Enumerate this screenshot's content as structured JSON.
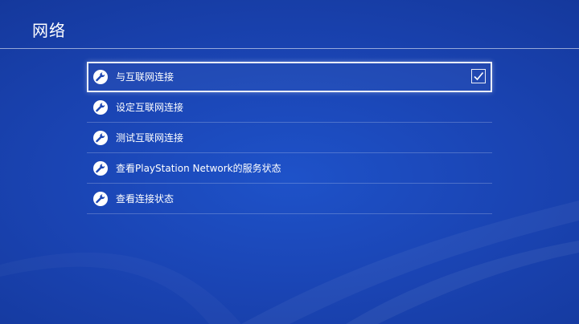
{
  "header": {
    "title": "网络"
  },
  "menu": {
    "items": [
      {
        "label": "与互联网连接",
        "icon": "wrench-icon",
        "selected": true,
        "checked": true
      },
      {
        "label": "设定互联网连接",
        "icon": "wrench-icon"
      },
      {
        "label": "测试互联网连接",
        "icon": "wrench-icon"
      },
      {
        "label": "查看PlayStation Network的服务状态",
        "icon": "wrench-icon"
      },
      {
        "label": "查看连接状态",
        "icon": "wrench-icon"
      }
    ]
  },
  "colors": {
    "background": "#1a44b3",
    "text": "#ffffff"
  }
}
